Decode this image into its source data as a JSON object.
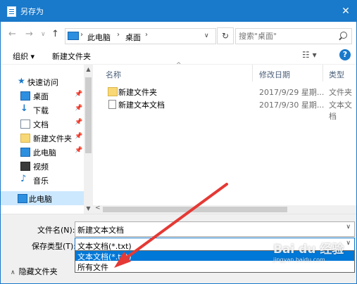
{
  "window": {
    "title": "另存为",
    "close_symbol": "✕"
  },
  "address": {
    "segments": [
      "此电脑",
      "桌面"
    ],
    "search_placeholder": "搜索\"桌面\""
  },
  "toolbar": {
    "organize_label": "组织 ▾",
    "new_folder_label": "新建文件夹",
    "view_symbol": "☷ ▾",
    "help_symbol": "?"
  },
  "sidebar": {
    "items": [
      {
        "label": "快速访问",
        "icon": "star-icon"
      },
      {
        "label": "桌面",
        "icon": "desktop-icon",
        "pinned": true
      },
      {
        "label": "下载",
        "icon": "download-icon",
        "pinned": true
      },
      {
        "label": "文档",
        "icon": "document-icon",
        "pinned": true
      },
      {
        "label": "新建文件夹",
        "icon": "folder-icon",
        "pinned": true
      },
      {
        "label": "此电脑",
        "icon": "computer-icon",
        "pinned": true
      },
      {
        "label": "视频",
        "icon": "video-icon"
      },
      {
        "label": "音乐",
        "icon": "music-icon"
      },
      {
        "label": "此电脑",
        "icon": "computer-icon",
        "selected": true
      }
    ]
  },
  "files": {
    "columns": [
      "名称",
      "修改日期",
      "类型"
    ],
    "rows": [
      {
        "name": "新建文件夹",
        "date": "2017/9/29 星期...",
        "type": "文件夹",
        "icon": "folder-icon"
      },
      {
        "name": "新建文本文档",
        "date": "2017/9/30 星期...",
        "type": "文本文档",
        "icon": "text-file-icon"
      }
    ]
  },
  "form": {
    "filename_label": "文件名(N):",
    "filename_value": "新建文本文档",
    "filetype_label": "保存类型(T):",
    "filetype_value": "文本文档(*.txt)",
    "filetype_options": [
      "文本文档(*.txt)",
      "所有文件"
    ],
    "hide_folders_label": "隐藏文件夹"
  },
  "watermark": {
    "main": "Bai du 经验",
    "sub": "jingyan.baidu.com"
  },
  "colors": {
    "accent": "#1979ca",
    "selection": "#0078d7",
    "annotation": "#e53935"
  }
}
